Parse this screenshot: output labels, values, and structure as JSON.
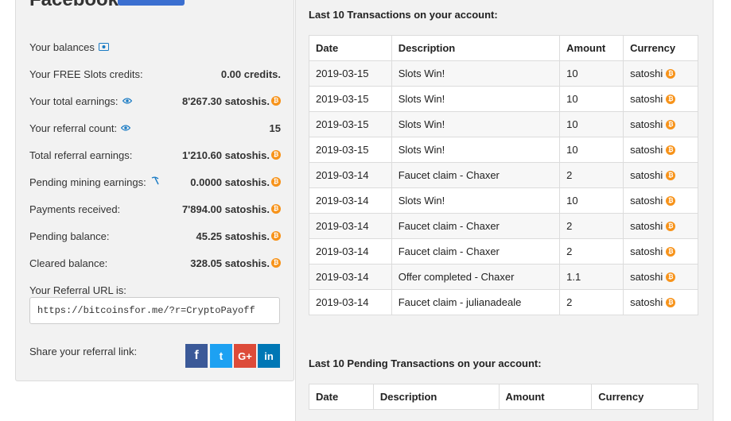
{
  "header": {
    "title": "Facebook:"
  },
  "account": {
    "balances_link": "Your balances",
    "free_slots_label": "Your FREE Slots credits:",
    "free_slots_value": "0.00 credits.",
    "total_earnings_label": "Your total earnings:",
    "total_earnings_value": "8'267.30 satoshis.",
    "referral_count_label": "Your referral count:",
    "referral_count_value": "15",
    "total_referral_label": "Total referral earnings:",
    "total_referral_value": "1'210.60 satoshis.",
    "pending_mining_label": "Pending mining earnings:",
    "pending_mining_value": "0.0000 satoshis.",
    "payments_received_label": "Payments received:",
    "payments_received_value": "7'894.00 satoshis.",
    "pending_balance_label": "Pending balance:",
    "pending_balance_value": "45.25 satoshis.",
    "cleared_balance_label": "Cleared balance:",
    "cleared_balance_value": "328.05 satoshis.",
    "referral_url_label": "Your Referral URL is:",
    "referral_url_value": "https://bitcoinsfor.me/?r=CryptoPayoff",
    "share_label": "Share your referral link:"
  },
  "transactions": {
    "title": "Last 10 Transactions on your account:",
    "columns": [
      "Date",
      "Description",
      "Amount",
      "Currency"
    ],
    "rows": [
      [
        "2019-03-15",
        "Slots Win!",
        "10",
        "satoshi"
      ],
      [
        "2019-03-15",
        "Slots Win!",
        "10",
        "satoshi"
      ],
      [
        "2019-03-15",
        "Slots Win!",
        "10",
        "satoshi"
      ],
      [
        "2019-03-15",
        "Slots Win!",
        "10",
        "satoshi"
      ],
      [
        "2019-03-14",
        "Faucet claim - Chaxer",
        "2",
        "satoshi"
      ],
      [
        "2019-03-14",
        "Slots Win!",
        "10",
        "satoshi"
      ],
      [
        "2019-03-14",
        "Faucet claim - Chaxer",
        "2",
        "satoshi"
      ],
      [
        "2019-03-14",
        "Faucet claim - Chaxer",
        "2",
        "satoshi"
      ],
      [
        "2019-03-14",
        "Offer completed - Chaxer",
        "1.1",
        "satoshi"
      ],
      [
        "2019-03-14",
        "Faucet claim - julianadeale",
        "2",
        "satoshi"
      ]
    ]
  },
  "pending": {
    "title": "Last 10 Pending Transactions on your account:",
    "columns": [
      "Date",
      "Description",
      "Amount",
      "Currency"
    ]
  },
  "icons": {
    "bitcoin_symbol": "₿",
    "facebook_symbol": "f",
    "twitter_symbol": "t",
    "googleplus_symbol": "G+",
    "linkedin_symbol": "in"
  },
  "colors": {
    "link": "#1a7bc4",
    "bitcoin": "#f7931a",
    "facebook": "#3b5998",
    "twitter": "#1da1f2",
    "googleplus": "#dd4b39",
    "linkedin": "#0077b5"
  }
}
